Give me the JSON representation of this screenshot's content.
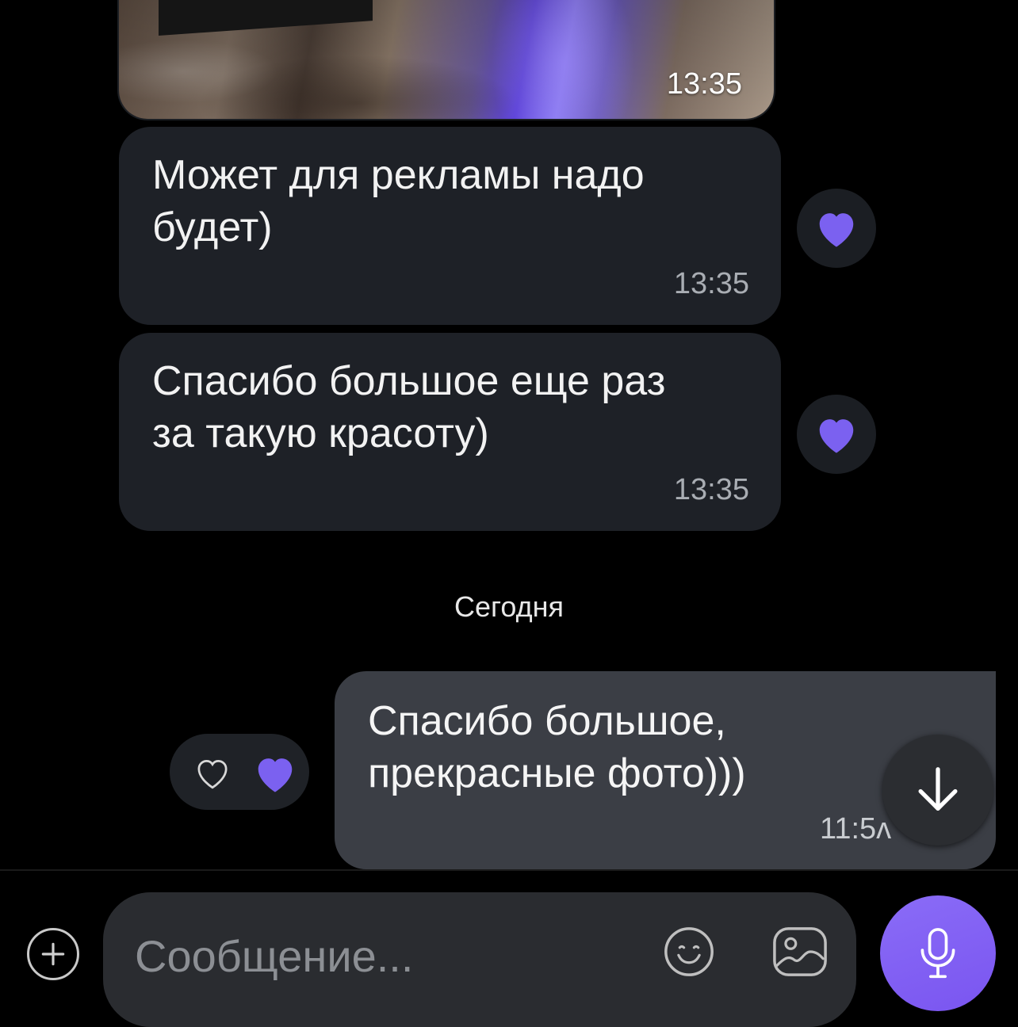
{
  "colors": {
    "background": "#000000",
    "incoming_bubble": "#1e2127",
    "outgoing_bubble": "#3b3e45",
    "accent_purple": "#7b61f0",
    "time_gray": "#a9adb3"
  },
  "messages": {
    "photo": {
      "time": "13:35"
    },
    "incoming": [
      {
        "line1": "Может для рекламы надо",
        "line2": "будет)",
        "time": "13:35",
        "reaction_icon": "heart-icon"
      },
      {
        "line1": "Спасибо большое еще раз",
        "line2": "за такую красоту)",
        "time": "13:35",
        "reaction_icon": "heart-icon"
      }
    ],
    "date_separator": "Сегодня",
    "outgoing": {
      "line1": "Спасибо большое,",
      "line2": "прекрасные фото)))",
      "time": "11:5ʌ"
    }
  },
  "reaction_picker": {
    "icons": [
      "heart-outline-icon",
      "heart-filled-icon"
    ]
  },
  "scroll_button": {
    "icon": "arrow-down-icon"
  },
  "composer": {
    "placeholder": "Сообщение...",
    "add_icon": "plus-circle-icon",
    "emoji_icon": "smile-icon",
    "gallery_icon": "image-icon",
    "mic_icon": "microphone-icon"
  }
}
